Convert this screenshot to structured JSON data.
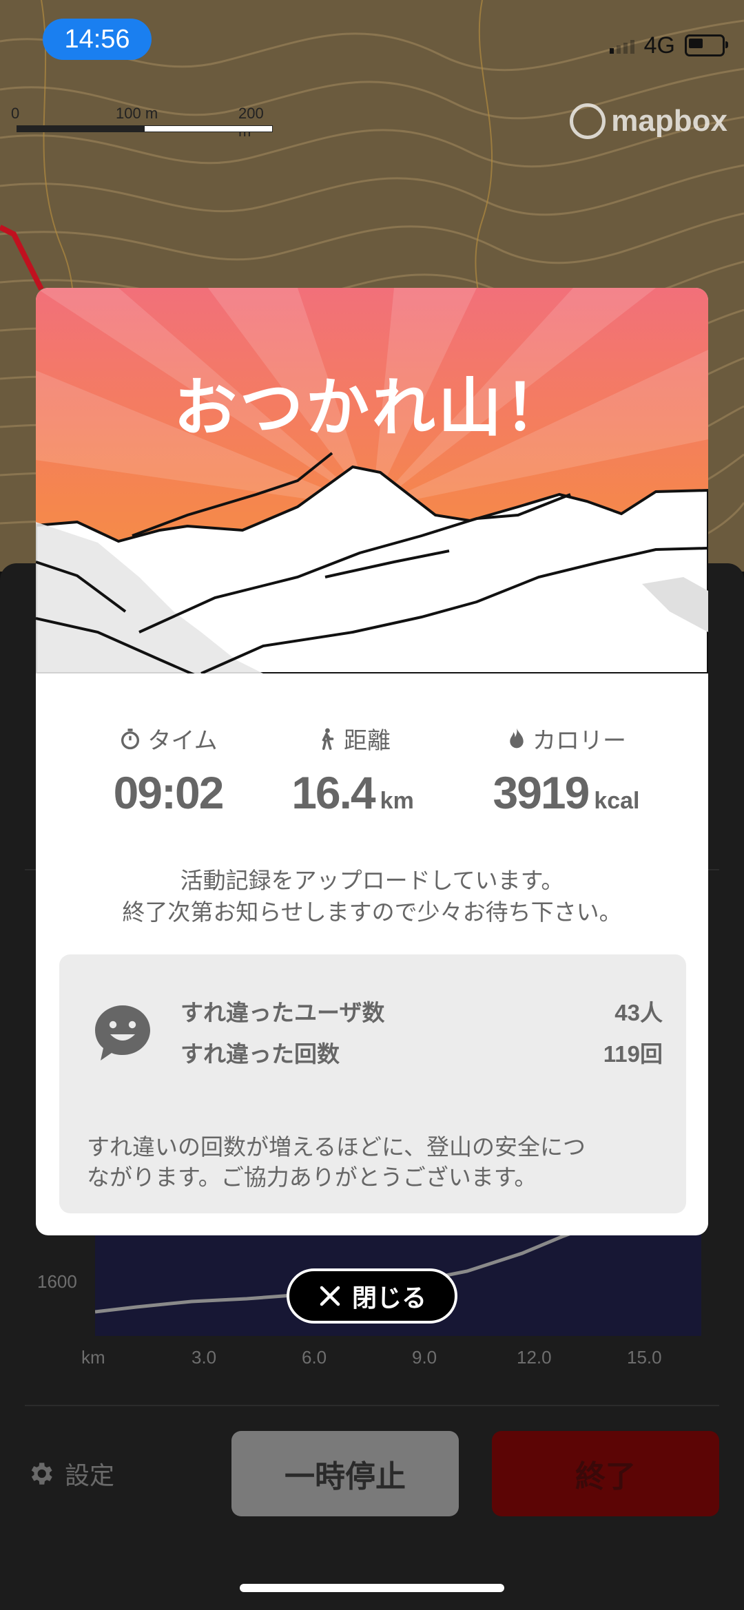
{
  "status_bar": {
    "time": "14:56",
    "network": "4G"
  },
  "map": {
    "scale_labels": [
      "0",
      "100 m",
      "200 m"
    ],
    "attribution": "mapbox"
  },
  "modal": {
    "title": "おつかれ山！",
    "stats": [
      {
        "icon": "stopwatch-icon",
        "label": "タイム",
        "value": "09:02",
        "unit": ""
      },
      {
        "icon": "hiker-icon",
        "label": "距離",
        "value": "16.4",
        "unit": "km"
      },
      {
        "icon": "flame-icon",
        "label": "カロリー",
        "value": "3919",
        "unit": "kcal"
      }
    ],
    "message_line1": "活動記録をアップロードしています。",
    "message_line2": "終了次第お知らせしますので少々お待ち下さい。",
    "encounter": {
      "users_label": "すれ違ったユーザ数",
      "users_value": "43人",
      "count_label": "すれ違った回数",
      "count_value": "119回",
      "note_line1": "すれ違いの回数が増えるほどに、登山の安全につ",
      "note_line2": "ながります。ご協力ありがとうございます。"
    }
  },
  "close_label": "閉じる",
  "chart": {
    "y_tick": "1600",
    "x_ticks": [
      "km",
      "3.0",
      "6.0",
      "9.0",
      "12.0",
      "15.0"
    ]
  },
  "footer": {
    "settings_label": "設定",
    "pause_label": "一時停止",
    "end_label": "終了"
  }
}
